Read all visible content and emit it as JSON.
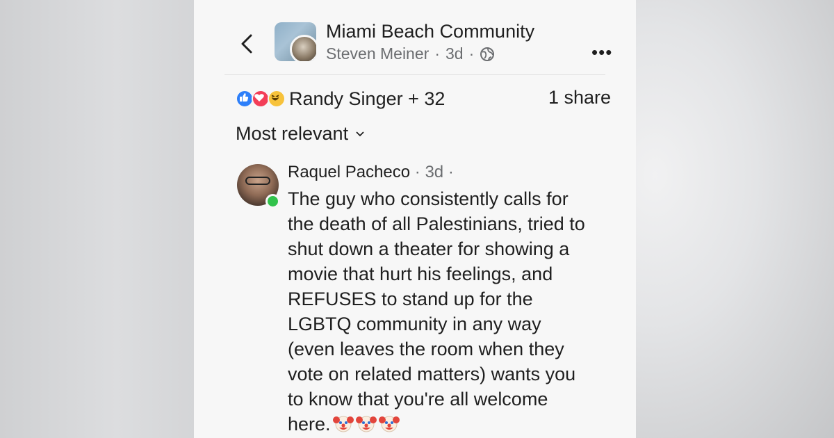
{
  "header": {
    "group_name": "Miami Beach Community",
    "author": "Steven Meiner",
    "time": "3d",
    "separator": "·",
    "visibility_icon": "globe-icon",
    "back_icon": "chevron-left-icon",
    "more_label": "•••"
  },
  "reactions": {
    "icons": [
      "like-icon",
      "love-icon",
      "haha-icon"
    ],
    "summary": "Randy Singer + 32",
    "shares": "1 share"
  },
  "sort": {
    "label": "Most relevant"
  },
  "comment": {
    "author": "Raquel Pacheco",
    "time": "· 3d ·",
    "lines": [
      "The guy who consistently calls for",
      "the death of all Palestinians, tried to",
      "shut down a theater for showing a",
      "movie that hurt his feelings, and",
      "REFUSES to stand up for the",
      "LGBTQ community in any way",
      "(even leaves the room when they",
      "vote on related matters) wants you",
      "to know that you're all welcome",
      "here."
    ],
    "trailing_emoji": [
      "clown-face-icon",
      "clown-face-icon",
      "clown-face-icon"
    ]
  },
  "colors": {
    "like": "#2d7ff9",
    "love": "#f33e58",
    "haha": "#f7c23b",
    "online": "#31c24b",
    "meta_text": "#6b6d70"
  }
}
